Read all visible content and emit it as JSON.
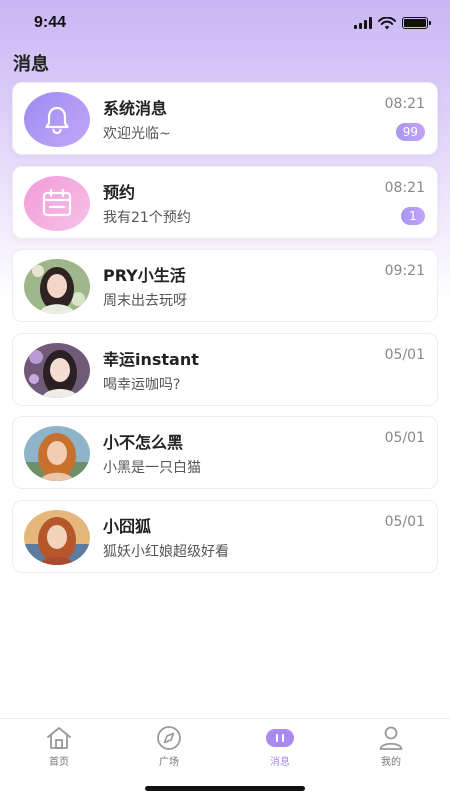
{
  "status_bar": {
    "time": "9:44"
  },
  "header": {
    "title": "消息"
  },
  "messages": [
    {
      "name": "系统消息",
      "preview": "欢迎光临~",
      "time": "08:21",
      "badge": "99",
      "icon": "bell-icon"
    },
    {
      "name": "预约",
      "preview": "我有21个预约",
      "time": "08:21",
      "badge": "1",
      "icon": "calendar-icon"
    },
    {
      "name": "PRY小生活",
      "preview": "周末出去玩呀",
      "time": "09:21"
    },
    {
      "name": "幸运instant",
      "preview": "喝幸运咖吗?",
      "time": "05/01"
    },
    {
      "name": "小不怎么黑",
      "preview": "小黑是一只白猫",
      "time": "05/01"
    },
    {
      "name": "小囧狐",
      "preview": "狐妖小红娘超级好看",
      "time": "05/01"
    }
  ],
  "tabbar": {
    "tabs": [
      {
        "label": "首页",
        "icon": "home-icon"
      },
      {
        "label": "广场",
        "icon": "compass-icon"
      },
      {
        "label": "消息",
        "icon": "chat-icon",
        "active": true
      },
      {
        "label": "我的",
        "icon": "user-icon"
      }
    ]
  },
  "colors": {
    "accent": "#a88af0",
    "badge_start": "#a996f4",
    "badge_end": "#c5a3f6",
    "header_gradient_top": "#c9b6f5"
  }
}
